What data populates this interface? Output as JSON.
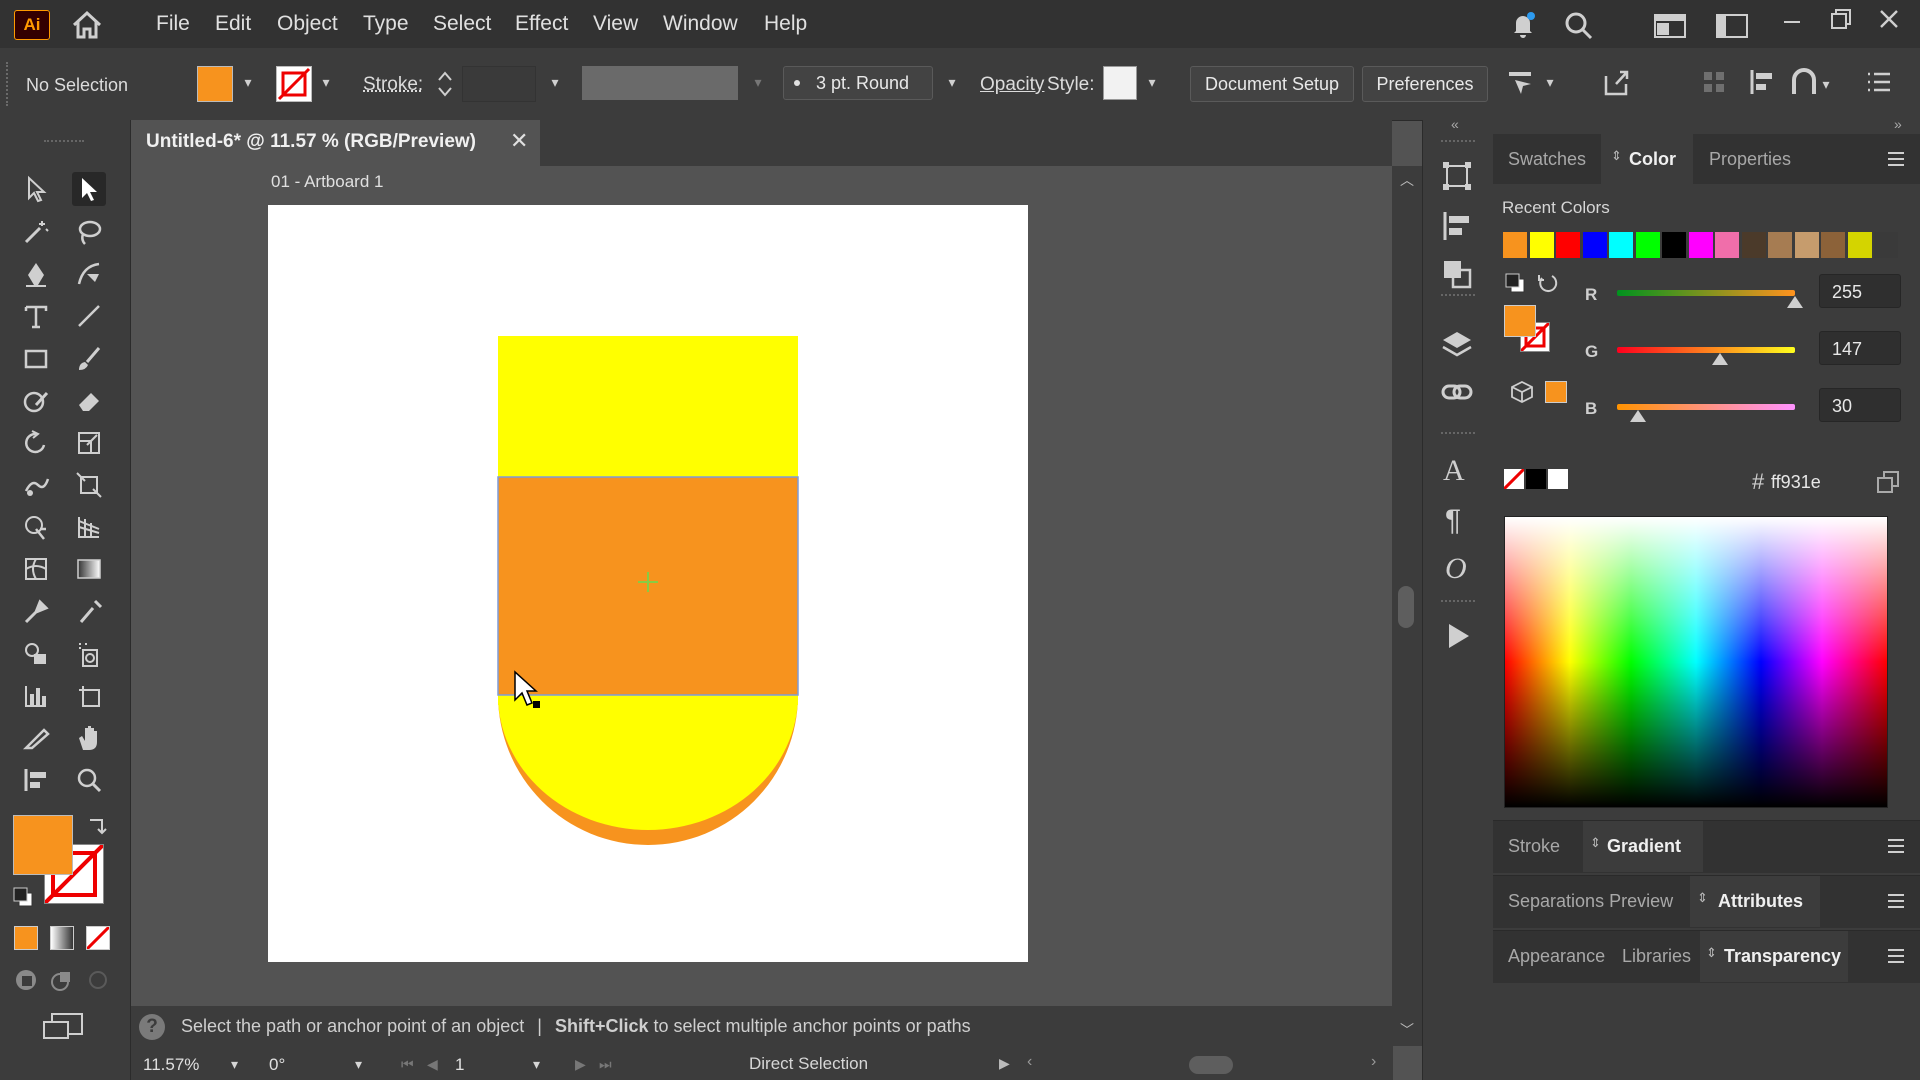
{
  "app": {
    "logo": "Ai"
  },
  "menu": [
    "File",
    "Edit",
    "Object",
    "Type",
    "Select",
    "Effect",
    "View",
    "Window",
    "Help"
  ],
  "control": {
    "selection": "No Selection",
    "stroke_label": "Stroke:",
    "brush_label": "3 pt. Round",
    "opacity_label": "Opacity",
    "style_label": "Style:",
    "document_setup": "Document Setup",
    "preferences": "Preferences"
  },
  "document": {
    "tab_title": "Untitled-6* @ 11.57 % (RGB/Preview)",
    "artboard_label": "01 - Artboard 1"
  },
  "colors": {
    "fill": "#ff931e",
    "yellow": "#ffff00",
    "orange": "#f7931e"
  },
  "panel": {
    "tabs_top": [
      "Swatches",
      "Color",
      "Properties"
    ],
    "recent_colors_label": "Recent Colors",
    "recent_colors": [
      "#f7931e",
      "#ffff00",
      "#ff0000",
      "#0000ff",
      "#00ffff",
      "#00ff00",
      "#000000",
      "#ff00ff",
      "#f06eaa",
      "#4b3a2a",
      "#a67c52",
      "#c69c6d",
      "#8c6239",
      "#d4d400"
    ],
    "rgb": {
      "r_label": "R",
      "r": "255",
      "g_label": "G",
      "g": "147",
      "b_label": "B",
      "b": "30"
    },
    "rgb_fraction": {
      "r": 1.0,
      "g": 0.576,
      "b": 0.118
    },
    "hex_symbol": "#",
    "hex": "ff931e",
    "stroke_tab": "Stroke",
    "gradient_tab": "Gradient",
    "separations_tab": "Separations Preview",
    "attributes_tab": "Attributes",
    "appearance_tab": "Appearance",
    "libraries_tab": "Libraries",
    "transparency_tab": "Transparency"
  },
  "status": {
    "hint_main": "Select the path or anchor point of an object",
    "hint_sep": "|",
    "hint_shift": "Shift+Click",
    "hint_rest": "to select multiple anchor points or paths",
    "zoom": "11.57%",
    "rotation": "0°",
    "artboard_num": "1",
    "tool_name": "Direct Selection"
  }
}
